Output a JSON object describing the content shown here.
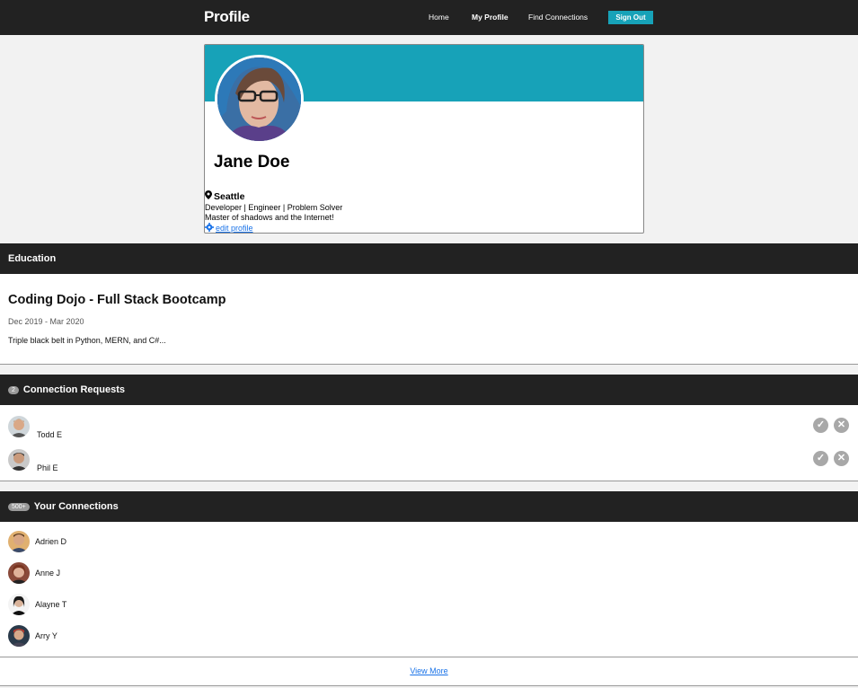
{
  "nav": {
    "brand": "Profile",
    "links": [
      "Home",
      "My Profile",
      "Find Connections"
    ],
    "signout": "Sign Out",
    "accent": "#17a2b8"
  },
  "profile": {
    "name": "Jane Doe",
    "location": "Seattle",
    "tagline": "Developer | Engineer | Problem Solver",
    "bio": "Master of shadows and the Internet!",
    "edit_label": "edit profile",
    "location_icon": "map-pin-icon",
    "edit_icon": "gear-icon"
  },
  "education": {
    "header": "Education",
    "title": "Coding Dojo - Full Stack Bootcamp",
    "dates": "Dec 2019 - Mar 2020",
    "description": "Triple black belt in Python, MERN, and C#..."
  },
  "requests": {
    "header": "Connection Requests",
    "count": "2",
    "items": [
      {
        "name": "Todd E"
      },
      {
        "name": "Phil E"
      }
    ],
    "accept_icon": "check-icon",
    "decline_icon": "close-icon"
  },
  "connections": {
    "header": "Your Connections",
    "count": "500+",
    "items": [
      {
        "name": "Adrien D"
      },
      {
        "name": "Anne J"
      },
      {
        "name": "Alayne T"
      },
      {
        "name": "Arry Y"
      }
    ],
    "view_more": "View More"
  }
}
